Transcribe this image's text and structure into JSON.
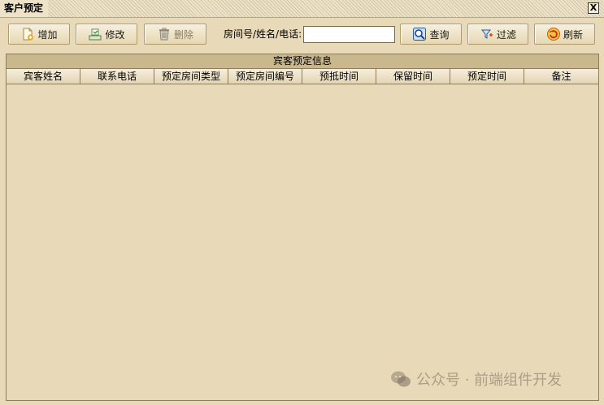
{
  "window": {
    "title": "客户预定",
    "close_label": "X"
  },
  "toolbar": {
    "add_label": "增加",
    "edit_label": "修改",
    "delete_label": "删除",
    "search_label": "房间号/姓名/电话:",
    "search_value": "",
    "query_label": "查询",
    "filter_label": "过滤",
    "refresh_label": "刷新"
  },
  "grid": {
    "title": "宾客预定信息",
    "columns": [
      "宾客姓名",
      "联系电话",
      "预定房间类型",
      "预定房间编号",
      "预抵时间",
      "保留时间",
      "预定时间",
      "备注"
    ],
    "rows": []
  },
  "watermark": {
    "text": "公众号 · 前端组件开发"
  },
  "icons": {
    "add": "document-add-icon",
    "edit": "edit-tray-icon",
    "delete": "trash-icon",
    "query": "magnifier-icon",
    "filter": "filter-icon",
    "refresh": "refresh-icon",
    "close": "close-icon"
  }
}
